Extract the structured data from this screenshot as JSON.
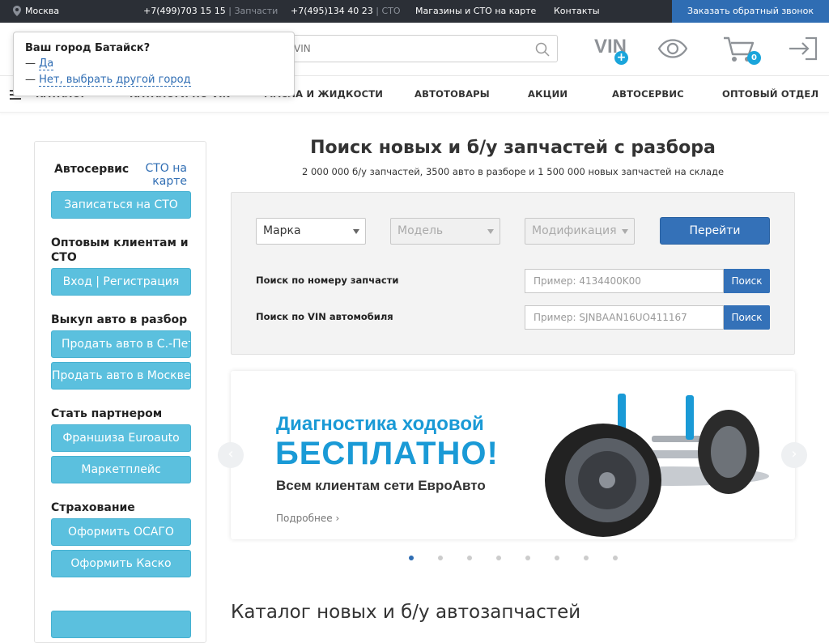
{
  "topbar": {
    "city": "Москва",
    "phone1": "+7(499)703 15 15",
    "phone1_label": "Запчасти",
    "phone2": "+7(495)134 40 23",
    "phone2_label": "СТО",
    "map_link": "Магазины и СТО на карте",
    "contacts_link": "Контакты",
    "callback_button": "Заказать обратный звонок"
  },
  "header": {
    "search_placeholder": "VIN",
    "vin_label": "VIN",
    "cart_count": "0"
  },
  "nav": {
    "items": [
      "КАТАЛОГ",
      "КАТАЛОГИ ПО VIN",
      "МАСЛА И ЖИДКОСТИ",
      "АВТОТОВАРЫ",
      "АКЦИИ",
      "АВТОСЕРВИС",
      "ОПТОВЫЙ ОТДЕЛ"
    ]
  },
  "city_popup": {
    "question": "Ваш город Батайск?",
    "dash": "—",
    "yes": "Да",
    "no": "Нет, выбрать другой город"
  },
  "sidebar": {
    "autoservice_heading": "Автосервис",
    "sto_map_link": "СТО на карте",
    "book_sto_button": "Записаться на СТО",
    "wholesale_heading": "Оптовым клиентам и СТО",
    "login_button": "Вход | Регистрация",
    "buyout_heading": "Выкуп авто в разбор",
    "sell_spb_button": "Продать авто в С.-Петербурге",
    "sell_msk_button": "Продать авто в Москве",
    "partner_heading": "Стать партнером",
    "franchise_button": "Франшиза Euroauto",
    "marketplace_button": "Маркетплейс",
    "insurance_heading": "Страхование",
    "osago_button": "Оформить ОСАГО",
    "kasko_button": "Оформить Каско"
  },
  "main": {
    "title": "Поиск новых и б/у запчастей с разбора",
    "subtitle": "2 000 000 б/у запчастей, 3500 авто в разборе и 1 500 000 новых запчастей на складе",
    "brand_select": "Марка",
    "model_select": "Модель",
    "mod_select": "Модификация",
    "go_button": "Перейти",
    "part_search_label": "Поиск по номеру запчасти",
    "part_placeholder": "Пример: 4134400K00",
    "vin_search_label": "Поиск по VIN автомобиля",
    "vin_placeholder": "Пример: SJNBAAN16UO411167",
    "search_button": "Поиск"
  },
  "banner": {
    "line1": "Диагностика ходовой",
    "line2": "БЕСПЛАТНО!",
    "line3": "Всем клиентам сети ЕвроАвто",
    "more_link": "Подробнее"
  },
  "carousel": {
    "slide_count": 8,
    "active_index": 0
  },
  "catalog_heading": "Каталог новых и б/у автозапчастей",
  "colors": {
    "accent": "#2f6db3",
    "sidebar_button": "#5bc0de",
    "topbar": "#2b2f36",
    "banner_text": "#1a9ad6"
  }
}
